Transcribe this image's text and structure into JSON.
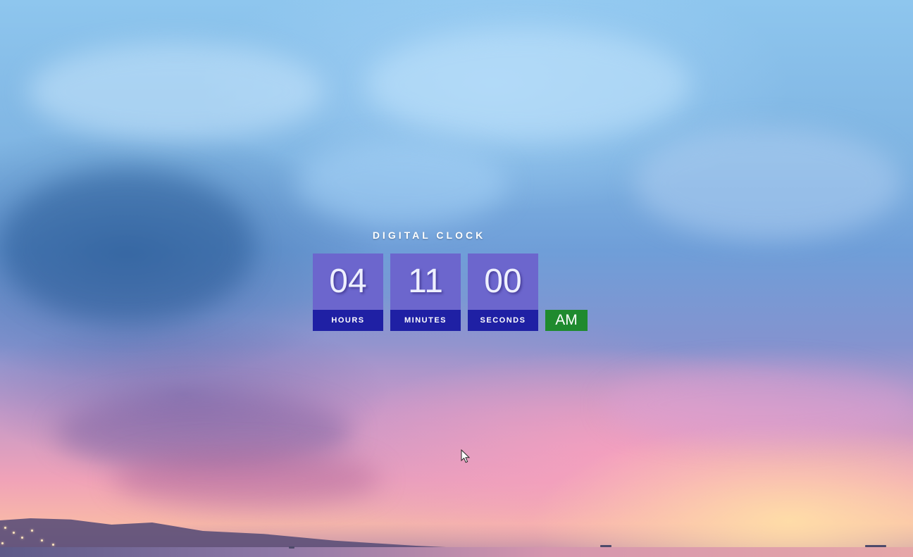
{
  "clock": {
    "title": "DIGITAL CLOCK",
    "hours": "04",
    "minutes": "11",
    "seconds": "00",
    "hours_label": "HOURS",
    "minutes_label": "MINUTES",
    "seconds_label": "SECONDS",
    "period": "AM"
  },
  "colors": {
    "value_box": "#6c66cd",
    "label_box": "#1f20a4",
    "period_box": "#1f8a2e"
  },
  "icons": {
    "cursor": "mouse-pointer-icon"
  }
}
